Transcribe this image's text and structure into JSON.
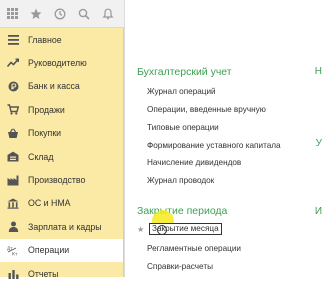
{
  "sidebar": {
    "toolbar_icons": [
      "apps-grid-icon",
      "star-icon",
      "history-icon",
      "search-icon",
      "bell-icon"
    ],
    "items": [
      {
        "label": "Главное",
        "icon": "menu-lines-icon"
      },
      {
        "label": "Руководителю",
        "icon": "trend-icon"
      },
      {
        "label": "Банк и касса",
        "icon": "coin-icon"
      },
      {
        "label": "Продажи",
        "icon": "cart-icon"
      },
      {
        "label": "Покупки",
        "icon": "basket-icon"
      },
      {
        "label": "Склад",
        "icon": "warehouse-icon"
      },
      {
        "label": "Производство",
        "icon": "factory-icon"
      },
      {
        "label": "ОС и НМА",
        "icon": "building-icon"
      },
      {
        "label": "Зарплата и кадры",
        "icon": "person-icon"
      },
      {
        "label": "Операции",
        "icon": "dt-kt-icon",
        "active": true
      },
      {
        "label": "Отчеты",
        "icon": "chart-icon"
      }
    ]
  },
  "content": {
    "section1": {
      "title": "Бухгалтерский учет",
      "links": [
        "Журнал операций",
        "Операции, введенные вручную",
        "Типовые операции",
        "Формирование уставного капитала",
        "Начисление дивидендов",
        "Журнал проводок"
      ]
    },
    "section2": {
      "title": "Закрытие периода",
      "links": [
        "Закрытие месяца",
        "Регламентные операции",
        "Справки-расчеты"
      ]
    },
    "right_edge_letters": [
      "Н",
      "У",
      "И"
    ]
  },
  "colors": {
    "sidebar_bg": "#fbeaa6",
    "section_title": "#3e9f52",
    "cursor_highlight": "#f5ec1e"
  }
}
